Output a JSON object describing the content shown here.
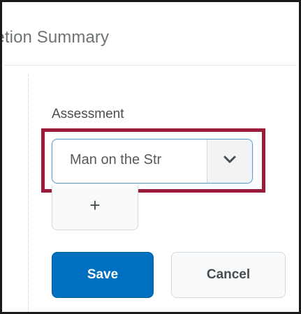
{
  "header": {
    "title": "letion Summary"
  },
  "form": {
    "assessment_label": "Assessment",
    "assessment_select": {
      "selected_value": "Man on the Str"
    },
    "add_button_label": "+",
    "save_label": "Save",
    "cancel_label": "Cancel"
  },
  "icons": {
    "dropdown": "chevron-down-icon",
    "add": "plus-icon"
  },
  "colors": {
    "primary_button": "#006fbf",
    "highlight_annotation": "#9b1b3a",
    "focus_border": "#5a9bd4"
  }
}
